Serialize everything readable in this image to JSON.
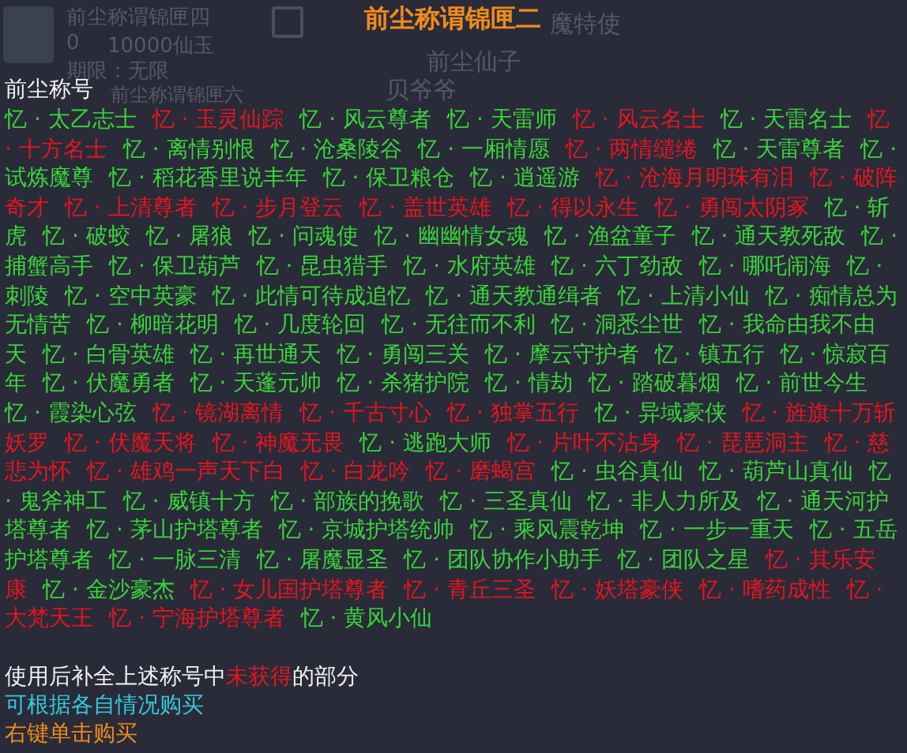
{
  "background": {
    "texts": [
      "前尘称谓锦匣四",
      "0",
      "10000仙玉",
      "期限：无限",
      "前尘称谓锦匣六",
      "魔特使",
      "前尘仙子",
      "贝爷爷"
    ]
  },
  "tooltip": {
    "title": "前尘称谓锦匣二",
    "section_label": "前尘称号",
    "titles": [
      {
        "text": "忆 · 太乙志士",
        "owned": true
      },
      {
        "text": "忆 · 玉灵仙踪",
        "owned": false
      },
      {
        "text": "忆 · 风云尊者",
        "owned": true
      },
      {
        "text": "忆 · 天雷师",
        "owned": true
      },
      {
        "text": "忆 · 风云名士",
        "owned": false
      },
      {
        "text": "忆 · 天雷名士",
        "owned": true
      },
      {
        "text": "忆 · 十方名士",
        "owned": false
      },
      {
        "text": "忆 · 离情别恨",
        "owned": true
      },
      {
        "text": "忆 · 沧桑陵谷",
        "owned": true
      },
      {
        "text": "忆 · 一厢情愿",
        "owned": true
      },
      {
        "text": "忆 · 两情缱绻",
        "owned": false
      },
      {
        "text": "忆 · 天雷尊者",
        "owned": true
      },
      {
        "text": "忆 · 试炼魔尊",
        "owned": true
      },
      {
        "text": "忆 · 稻花香里说丰年",
        "owned": true
      },
      {
        "text": "忆 · 保卫粮仓",
        "owned": true
      },
      {
        "text": "忆 · 逍遥游",
        "owned": true
      },
      {
        "text": "忆 · 沧海月明珠有泪",
        "owned": false
      },
      {
        "text": "忆 · 破阵奇才",
        "owned": false
      },
      {
        "text": "忆 · 上清尊者",
        "owned": false
      },
      {
        "text": "忆 · 步月登云",
        "owned": false
      },
      {
        "text": "忆 · 盖世英雄",
        "owned": false
      },
      {
        "text": "忆 · 得以永生",
        "owned": false
      },
      {
        "text": "忆 · 勇闯太阴冢",
        "owned": false
      },
      {
        "text": "忆 · 斩虎",
        "owned": true
      },
      {
        "text": "忆 · 破蛟",
        "owned": true
      },
      {
        "text": "忆 · 屠狼",
        "owned": true
      },
      {
        "text": "忆 · 问魂使",
        "owned": true
      },
      {
        "text": "忆 · 幽幽情女魂",
        "owned": true
      },
      {
        "text": "忆 · 渔盆童子",
        "owned": true
      },
      {
        "text": "忆 · 通天教死敌",
        "owned": true
      },
      {
        "text": "忆 · 捕蟹高手",
        "owned": true
      },
      {
        "text": "忆 · 保卫葫芦",
        "owned": true
      },
      {
        "text": "忆 · 昆虫猎手",
        "owned": true
      },
      {
        "text": "忆 · 水府英雄",
        "owned": true
      },
      {
        "text": "忆 · 六丁劲敌",
        "owned": true
      },
      {
        "text": "忆 · 哪吒闹海",
        "owned": true
      },
      {
        "text": "忆 · 刺陵",
        "owned": true
      },
      {
        "text": "忆 · 空中英豪",
        "owned": true
      },
      {
        "text": "忆 · 此情可待成追忆",
        "owned": true
      },
      {
        "text": "忆 · 通天教通缉者",
        "owned": true
      },
      {
        "text": "忆 · 上清小仙",
        "owned": true
      },
      {
        "text": "忆 · 痴情总为无情苦",
        "owned": true
      },
      {
        "text": "忆 · 柳暗花明",
        "owned": true
      },
      {
        "text": "忆 · 几度轮回",
        "owned": true
      },
      {
        "text": "忆 · 无往而不利",
        "owned": true
      },
      {
        "text": "忆 · 洞悉尘世",
        "owned": true
      },
      {
        "text": "忆 · 我命由我不由天",
        "owned": true
      },
      {
        "text": "忆 · 白骨英雄",
        "owned": true
      },
      {
        "text": "忆 · 再世通天",
        "owned": true
      },
      {
        "text": "忆 · 勇闯三关",
        "owned": true
      },
      {
        "text": "忆 · 摩云守护者",
        "owned": true
      },
      {
        "text": "忆 · 镇五行",
        "owned": true
      },
      {
        "text": "忆 · 惊寂百年",
        "owned": true
      },
      {
        "text": "忆 · 伏魔勇者",
        "owned": true
      },
      {
        "text": "忆 · 天蓬元帅",
        "owned": true
      },
      {
        "text": "忆 · 杀猪护院",
        "owned": true
      },
      {
        "text": "忆 · 情劫",
        "owned": true
      },
      {
        "text": "忆 · 踏破暮烟",
        "owned": true
      },
      {
        "text": "忆 · 前世今生",
        "owned": true
      },
      {
        "text": "忆 · 霞染心弦",
        "owned": true
      },
      {
        "text": "忆 · 镜湖离情",
        "owned": false
      },
      {
        "text": "忆 · 千古寸心",
        "owned": false
      },
      {
        "text": "忆 · 独掌五行",
        "owned": false
      },
      {
        "text": "忆 · 异域豪侠",
        "owned": true
      },
      {
        "text": "忆 · 旌旗十万斩妖罗",
        "owned": false
      },
      {
        "text": "忆 · 伏魔天将",
        "owned": false
      },
      {
        "text": "忆 · 神魔无畏",
        "owned": false
      },
      {
        "text": "忆 · 逃跑大师",
        "owned": true
      },
      {
        "text": "忆 · 片叶不沾身",
        "owned": false
      },
      {
        "text": "忆 · 琵琶洞主",
        "owned": false
      },
      {
        "text": "忆 · 慈悲为怀",
        "owned": false
      },
      {
        "text": "忆 · 雄鸡一声天下白",
        "owned": false
      },
      {
        "text": "忆 · 白龙吟",
        "owned": false
      },
      {
        "text": "忆 · 磨蝎宫",
        "owned": false
      },
      {
        "text": "忆 · 虫谷真仙",
        "owned": true
      },
      {
        "text": "忆 · 葫芦山真仙",
        "owned": true
      },
      {
        "text": "忆 · 鬼斧神工",
        "owned": true
      },
      {
        "text": "忆 · 威镇十方",
        "owned": true
      },
      {
        "text": "忆 · 部族的挽歌",
        "owned": true
      },
      {
        "text": "忆 · 三圣真仙",
        "owned": true
      },
      {
        "text": "忆 · 非人力所及",
        "owned": true
      },
      {
        "text": "忆 · 通天河护塔尊者",
        "owned": true
      },
      {
        "text": "忆 · 茅山护塔尊者",
        "owned": true
      },
      {
        "text": "忆 · 京城护塔统帅",
        "owned": true
      },
      {
        "text": "忆 · 乘风震乾坤",
        "owned": true
      },
      {
        "text": "忆 · 一步一重天",
        "owned": true
      },
      {
        "text": "忆 · 五岳护塔尊者",
        "owned": true
      },
      {
        "text": "忆 · 一脉三清",
        "owned": true
      },
      {
        "text": "忆 · 屠魔显圣",
        "owned": true
      },
      {
        "text": "忆 · 团队协作小助手",
        "owned": true
      },
      {
        "text": "忆 · 团队之星",
        "owned": true
      },
      {
        "text": "忆 · 其乐安康",
        "owned": false
      },
      {
        "text": "忆 · 金沙豪杰",
        "owned": true
      },
      {
        "text": "忆 · 女儿国护塔尊者",
        "owned": false
      },
      {
        "text": "忆 · 青丘三圣",
        "owned": false
      },
      {
        "text": "忆 · 妖塔豪侠",
        "owned": false
      },
      {
        "text": "忆 · 嗜药成性",
        "owned": false
      },
      {
        "text": "忆 · 大梵天王",
        "owned": false
      },
      {
        "text": "忆 · 宁海护塔尊者",
        "owned": false
      },
      {
        "text": "忆 · 黄风小仙",
        "owned": true
      }
    ],
    "usage_note": {
      "before": "使用后补全上述称号中",
      "highlight": "未获得",
      "after": "的部分"
    },
    "hint": "可根据各自情况购买",
    "action": "右键单击购买"
  }
}
